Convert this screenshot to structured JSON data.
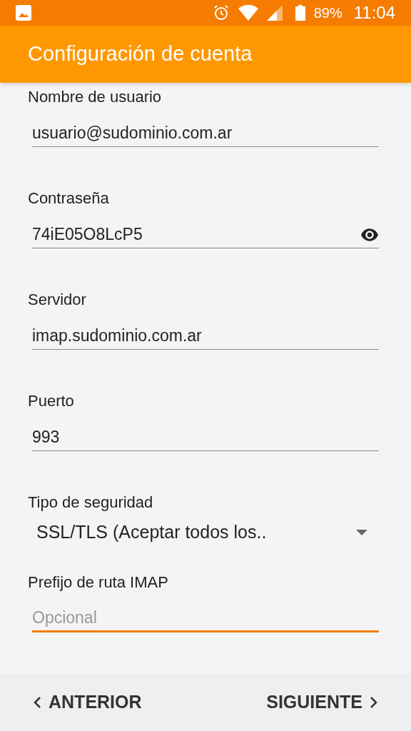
{
  "status_bar": {
    "battery": "89%",
    "time": "11:04"
  },
  "app_bar": {
    "title": "Configuración de cuenta"
  },
  "fields": [
    {
      "kind": "text",
      "label": "Nombre de usuario",
      "value": "usuario@sudominio.com.ar",
      "focused": false
    },
    {
      "kind": "password",
      "label": "Contraseña",
      "value": "74iE05O8LcP5",
      "focused": false
    },
    {
      "kind": "text",
      "label": "Servidor",
      "value": "imap.sudominio.com.ar",
      "focused": false
    },
    {
      "kind": "text",
      "label": "Puerto",
      "value": "993",
      "focused": false
    },
    {
      "kind": "select",
      "label": "Tipo de seguridad",
      "value": "SSL/TLS (Aceptar todos los.."
    },
    {
      "kind": "text",
      "label": "Prefijo de ruta IMAP",
      "placeholder": "Opcional",
      "focused": true
    }
  ],
  "footer": {
    "back": "ANTERIOR",
    "next": "SIGUIENTE"
  }
}
